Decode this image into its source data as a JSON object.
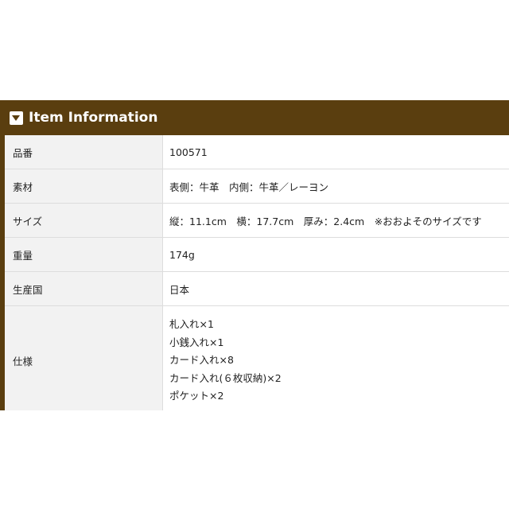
{
  "section": {
    "title": "Item Information",
    "icon": "caret-down-icon",
    "header_color": "#5a3e0f"
  },
  "rows": [
    {
      "label": "品番",
      "value": "100571"
    },
    {
      "label": "素材",
      "value": "表側：牛革　内側：牛革／レーヨン"
    },
    {
      "label": "サイズ",
      "value": "縦：11.1cm　横：17.7cm　厚み：2.4cm　※おおよそのサイズです"
    },
    {
      "label": "重量",
      "value": "174g"
    },
    {
      "label": "生産国",
      "value": "日本"
    },
    {
      "label": "仕様",
      "lines": [
        "札入れ×1",
        "小銭入れ×1",
        "カード入れ×8",
        "カード入れ(６枚収納)×2",
        "ポケット×2"
      ]
    }
  ]
}
